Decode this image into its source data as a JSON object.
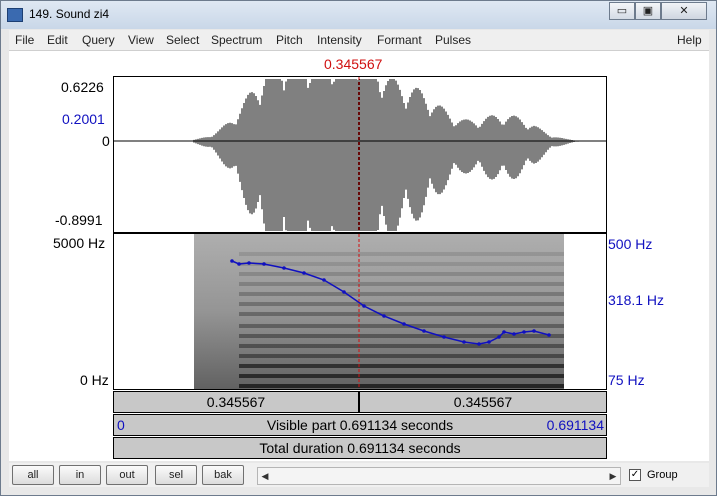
{
  "window": {
    "title": "149. Sound zi4",
    "minimize": "▭",
    "maximize": "▣",
    "close": "✕"
  },
  "menu": [
    "File",
    "Edit",
    "Query",
    "View",
    "Select",
    "Spectrum",
    "Pitch",
    "Intensity",
    "Formant",
    "Pulses"
  ],
  "menu_help": "Help",
  "cursor_time": "0.345567",
  "waveform": {
    "max": "0.6226",
    "level": "0.2001",
    "zero": "0",
    "min": "-0.8991"
  },
  "spectrogram": {
    "freq_top": "5000 Hz",
    "freq_bottom": "0 Hz"
  },
  "pitch_axis": {
    "top": "500 Hz",
    "mid": "318.1 Hz",
    "bottom": "75 Hz"
  },
  "bars": {
    "left_part": "0.345567",
    "right_part": "0.345567",
    "visible_start": "0",
    "visible_part": "Visible part 0.691134 seconds",
    "visible_end": "0.691134",
    "total": "Total duration 0.691134 seconds"
  },
  "buttons": [
    "all",
    "in",
    "out",
    "sel",
    "bak"
  ],
  "group_label": "Group",
  "group_checked": true,
  "colors": {
    "cursor": "#d01010",
    "pitch": "#1010c0"
  }
}
